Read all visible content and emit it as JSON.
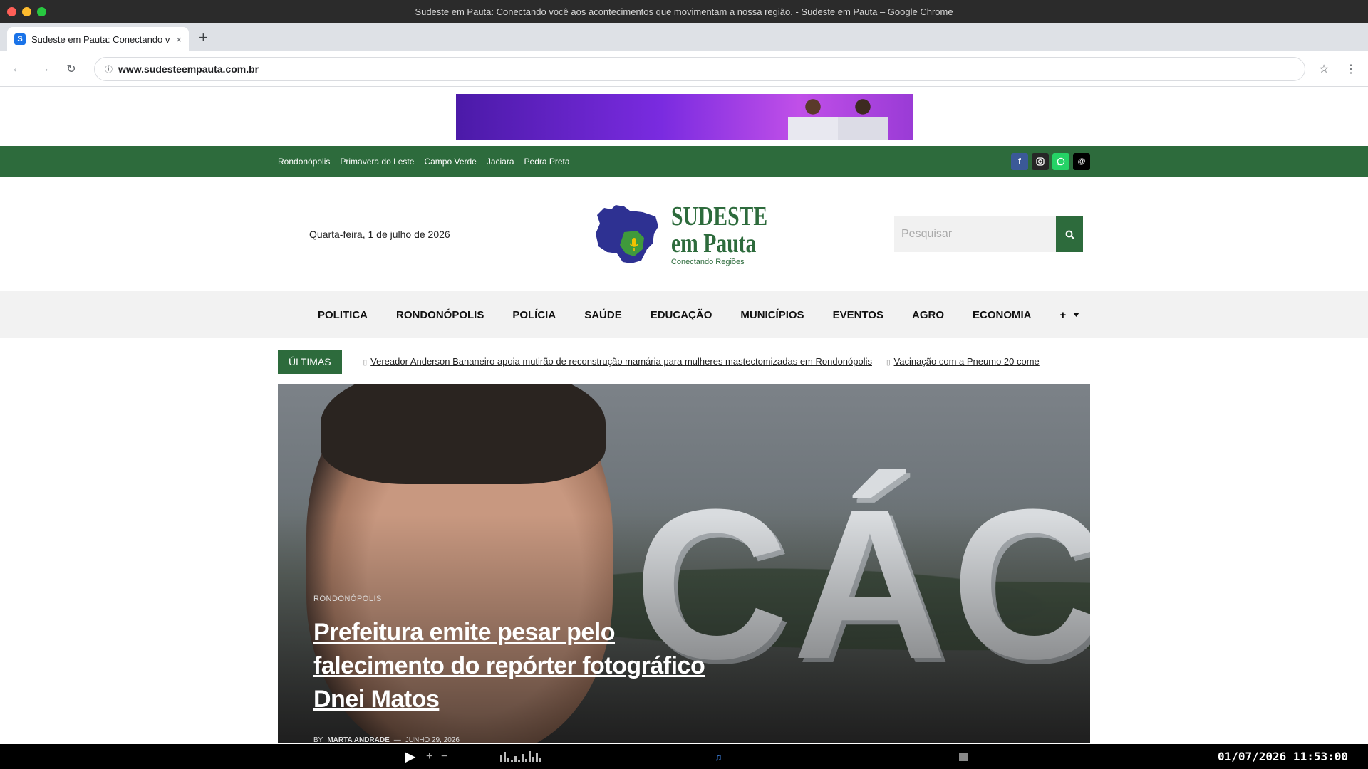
{
  "window": {
    "title": "Sudeste em Pauta: Conectando você aos acontecimentos que movimentam a nossa região. - Sudeste em Pauta – Google Chrome"
  },
  "tab": {
    "favicon_letter": "S",
    "label": "Sudeste em Pauta: Conectando v…",
    "close": "×",
    "new_tab": "+"
  },
  "toolbar": {
    "back": "←",
    "forward": "→",
    "reload": "↻",
    "url": "www.sudesteempauta.com.br",
    "bookmark": "☆",
    "menu": "⋮"
  },
  "topbar": {
    "cities": [
      "Rondonópolis",
      "Primavera do Leste",
      "Campo Verde",
      "Jaciara",
      "Pedra Preta"
    ],
    "social_icons": [
      "facebook-icon",
      "instagram-icon",
      "whatsapp-icon",
      "threads-icon"
    ]
  },
  "header": {
    "date": "Quarta-feira, 1 de julho de 2026",
    "logo_line1": "SUDESTE",
    "logo_line2": "em Pauta",
    "logo_tagline": "Conectando Regiões",
    "search_placeholder": "Pesquisar"
  },
  "nav": {
    "items": [
      "POLITICA",
      "RONDONÓPOLIS",
      "POLÍCIA",
      "SAÚDE",
      "EDUCAÇÃO",
      "MUNICÍPIOS",
      "EVENTOS",
      "AGRO",
      "ECONOMIA"
    ],
    "more": "+"
  },
  "ticker": {
    "label": "ÚLTIMAS",
    "items": [
      "Vereador Anderson Bananeiro apoia mutirão de reconstrução mamária para mulheres mastectomizadas em Rondonópolis",
      "Vacinação com a Pneumo 20 come"
    ]
  },
  "hero": {
    "category": "RONDONÓPOLIS",
    "headline": "Prefeitura emite pesar pelo falecimento do repórter fotográfico Dnei Matos",
    "by": "BY",
    "author": "MARTA ANDRADE",
    "separator": "—",
    "date": "JUNHO 29, 2026",
    "sign_text": "CÁCE"
  },
  "systembar": {
    "datetime": "01/07/2026 11:53:00"
  },
  "colors": {
    "brand_green": "#2d6b3c",
    "logo_blue": "#2e3192"
  }
}
